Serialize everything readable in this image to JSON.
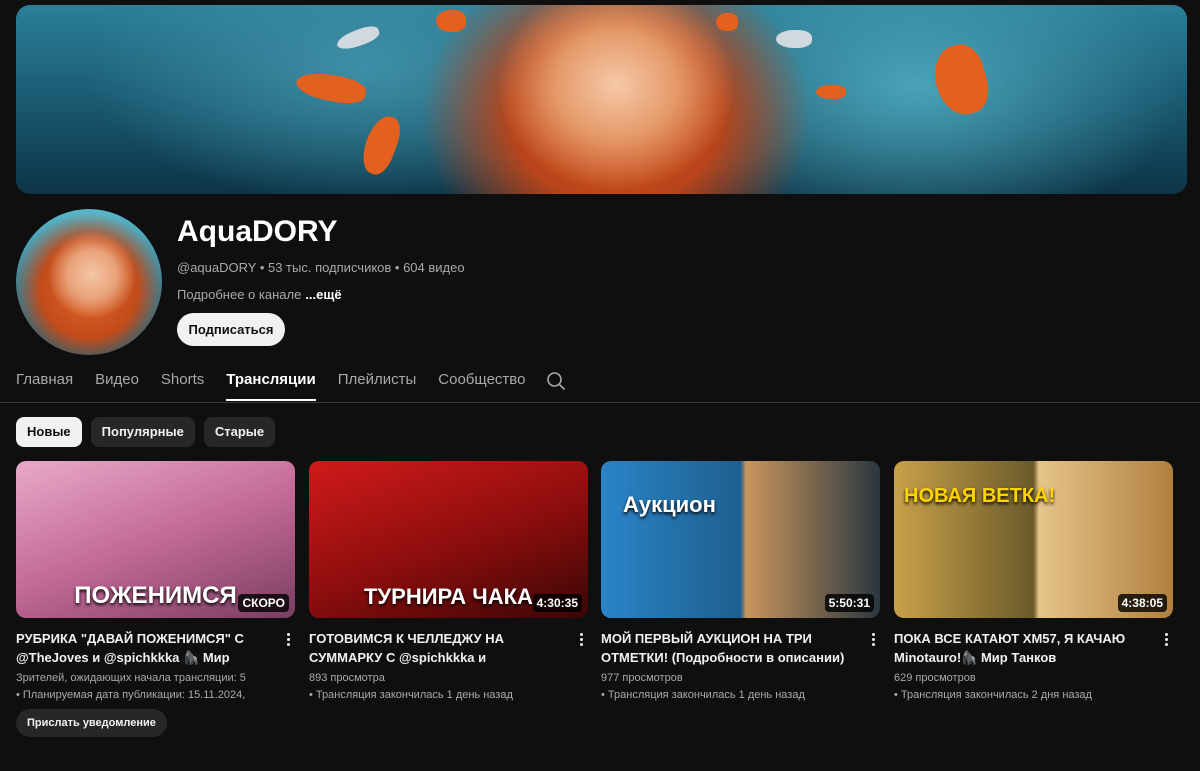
{
  "channel": {
    "name": "AquaDORY",
    "meta": "@aquaDORY • 53 тыс. подписчиков • 604 видео",
    "about": "Подробнее о канале",
    "more": "...ещё",
    "subscribe_label": "Подписаться"
  },
  "tabs": [
    {
      "label": "Главная",
      "active": false
    },
    {
      "label": "Видео",
      "active": false
    },
    {
      "label": "Shorts",
      "active": false
    },
    {
      "label": "Трансляции",
      "active": true
    },
    {
      "label": "Плейлисты",
      "active": false
    },
    {
      "label": "Сообщество",
      "active": false
    }
  ],
  "search_icon": "search-icon",
  "chips": [
    {
      "label": "Новые",
      "active": true
    },
    {
      "label": "Популярные",
      "active": false
    },
    {
      "label": "Старые",
      "active": false
    }
  ],
  "videos": [
    {
      "thumb_text": "ПОЖЕНИМСЯ",
      "badge": "СКОРО",
      "title": "РУБРИКА \"ДАВАЙ ПОЖЕНИМСЯ\" С @TheJoves и @spichkkka 🦍 Мир Танков",
      "line1": "Зрителей, ожидающих начала трансляции: 5",
      "line2": "• Планируемая дата публикации: 15.11.2024,",
      "button": "Прислать уведомление",
      "colors": [
        "#e9a9c8",
        "#7a3d62"
      ]
    },
    {
      "thumb_text": "ТУРНИРА ЧАКА",
      "badge": "4:30:35",
      "title": "ГОТОВИМСЯ К ЧЕЛЛЕДЖУ НА СУММАРКУ С @spichkkka и @соколина...",
      "line1": "893 просмотра",
      "line2": "• Трансляция закончилась 1 день назад",
      "colors": [
        "#d11a1a",
        "#3a0606"
      ]
    },
    {
      "thumb_text": "Аукцион",
      "badge": "5:50:31",
      "title": "МОЙ ПЕРВЫЙ АУКЦИОН НА ТРИ ОТМЕТКИ! (Подробности в описании)🦍 ...",
      "line1": "977 просмотров",
      "line2": "• Трансляция закончилась 1 день назад",
      "colors": [
        "#2a84c8",
        "#2a3640"
      ]
    },
    {
      "thumb_text": "НОВАЯ ВЕТКА!",
      "badge": "4:38:05",
      "title": "ПОКА ВСЕ КАТАЮТ XM57, Я КАЧАЮ Minotauro!🦍 Мир Танков",
      "line1": "629 просмотров",
      "line2": "• Трансляция закончилась 2 дня назад",
      "colors": [
        "#c9a14a",
        "#6a5a2a"
      ]
    }
  ]
}
